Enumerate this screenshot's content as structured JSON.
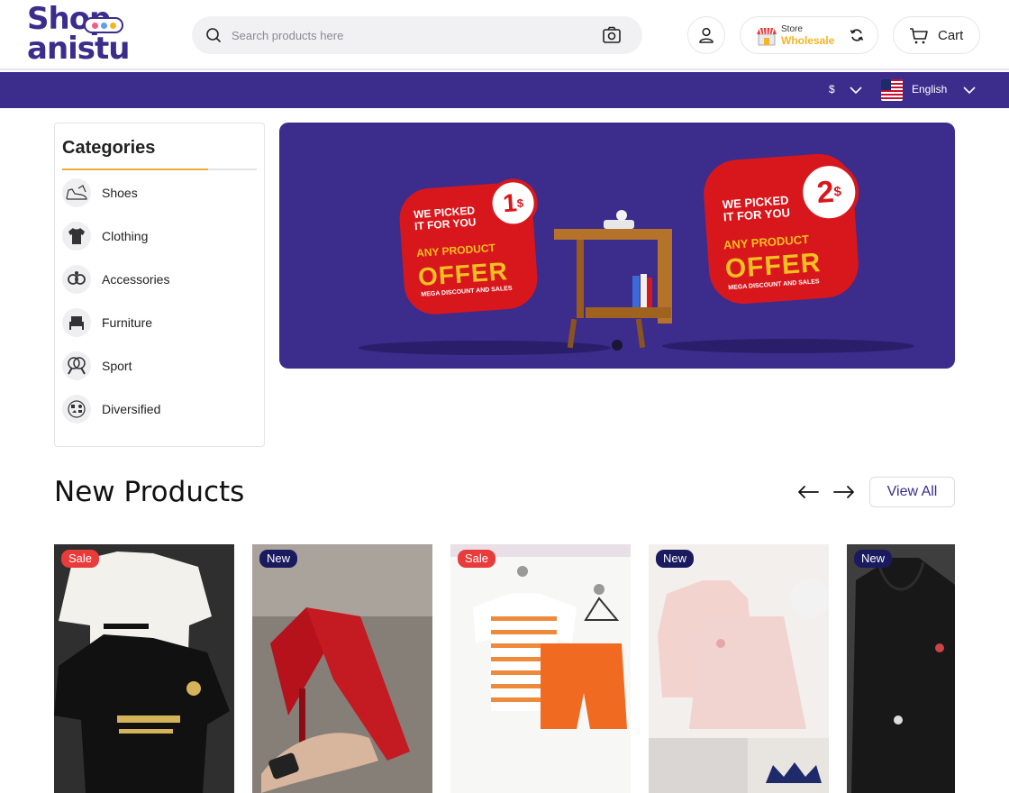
{
  "brand": {
    "line1": "Shop",
    "line2": "anistu",
    "dot_colors": [
      "#f25c8c",
      "#5aa0f2",
      "#f5b428"
    ]
  },
  "header": {
    "search_placeholder": "Search products here",
    "store": {
      "top": "Store",
      "bottom": "Wholesale"
    },
    "cart_label": "Cart"
  },
  "topband": {
    "currency": "$",
    "language": "English"
  },
  "categories": {
    "title": "Categories",
    "items": [
      {
        "label": "Shoes",
        "icon": "shoe-icon"
      },
      {
        "label": "Clothing",
        "icon": "clothing-icon"
      },
      {
        "label": "Accessories",
        "icon": "accessories-icon"
      },
      {
        "label": "Furniture",
        "icon": "furniture-icon"
      },
      {
        "label": "Sport",
        "icon": "sport-icon"
      },
      {
        "label": "Diversified",
        "icon": "diversified-icon"
      }
    ]
  },
  "hero": {
    "card_left": {
      "line1": "WE PICKED",
      "line2": "IT FOR YOU",
      "price": "1",
      "currency": "$",
      "offer": "ANY PRODUCT",
      "big": "OFFER",
      "sub": "MEGA DISCOUNT AND SALES"
    },
    "card_right": {
      "line1": "WE PICKED",
      "line2": "IT FOR YOU",
      "price": "2",
      "currency": "$",
      "offer": "ANY PRODUCT",
      "big": "OFFER",
      "sub": "MEGA DISCOUNT AND SALES"
    },
    "slide_dots": 1
  },
  "new_products": {
    "title": "New Products",
    "view_all": "View All",
    "items": [
      {
        "badge": "Sale",
        "image": "football-jerseys-photo"
      },
      {
        "badge": "New",
        "image": "red-heels-photo"
      },
      {
        "badge": "Sale",
        "image": "kids-striped-outfit-photo"
      },
      {
        "badge": "New",
        "image": "girls-pink-dress-photo"
      },
      {
        "badge": "New",
        "image": "black-hoodie-photo"
      }
    ]
  },
  "colors": {
    "brand": "#3c2c8c",
    "accent": "#f0a93a",
    "sale": "#ea3b3b",
    "new": "#1a1a5e",
    "offer_red": "#d8171c",
    "offer_yellow": "#f5c020"
  }
}
